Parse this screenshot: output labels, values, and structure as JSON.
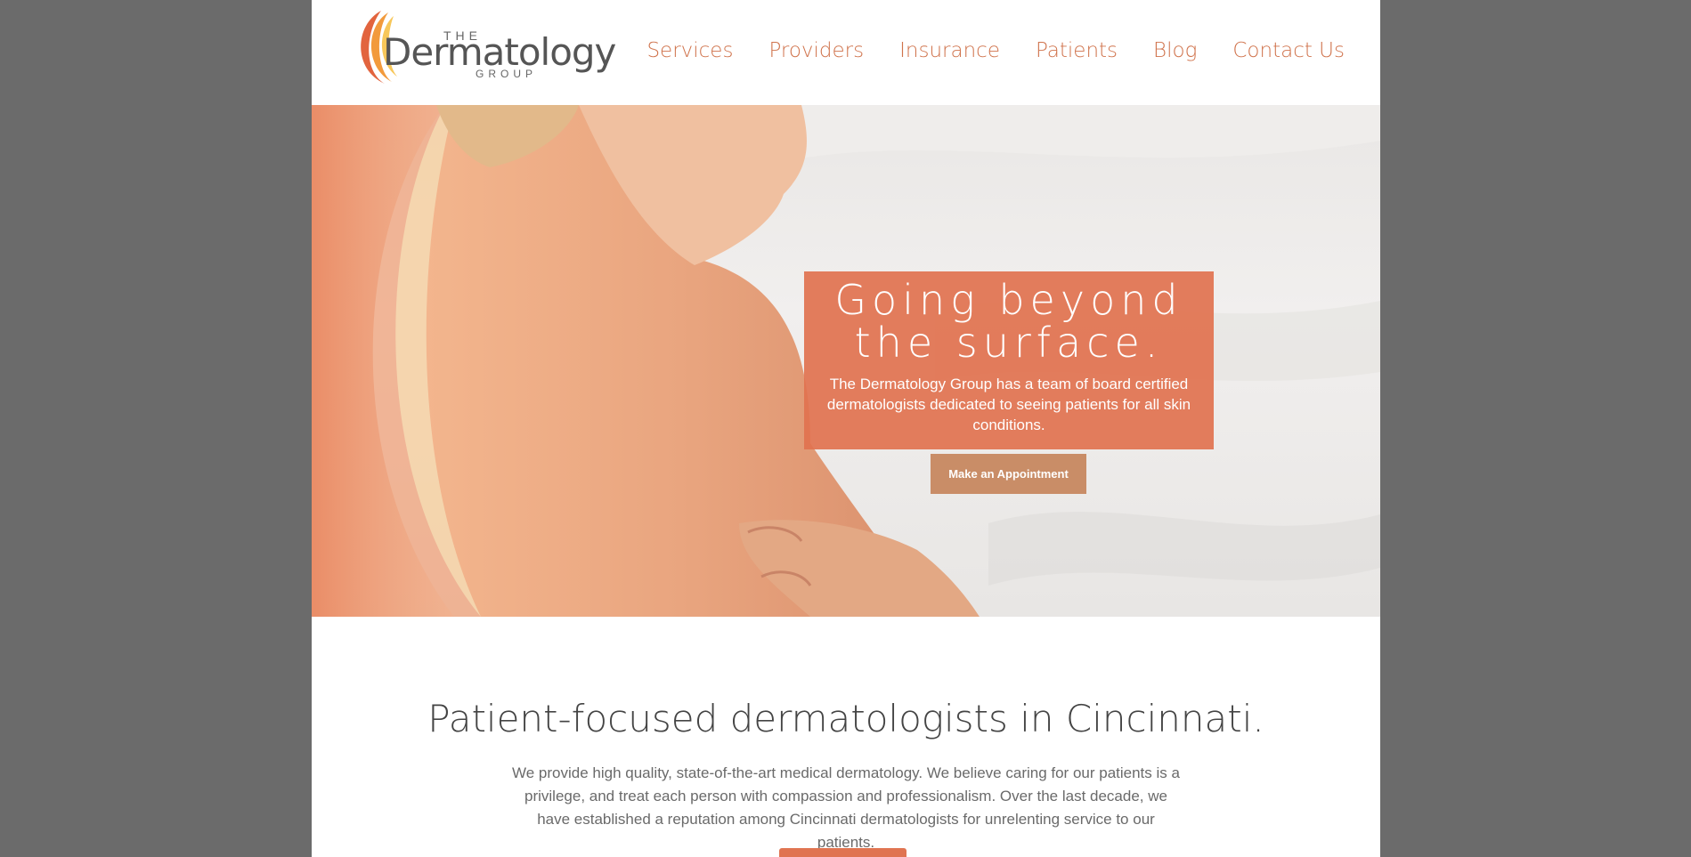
{
  "header": {
    "logo": {
      "the": "THE",
      "name": "Dermatology",
      "group": "GROUP"
    },
    "nav": [
      "Services",
      "Providers",
      "Insurance",
      "Patients",
      "Blog",
      "Contact Us"
    ]
  },
  "hero": {
    "title_line1": "Going beyond",
    "title_line2": "the surface.",
    "subtitle": "The Dermatology Group has a team of board certified dermatologists dedicated to seeing patients for all skin conditions.",
    "button": "Make an Appointment"
  },
  "intro": {
    "title": "Patient-focused dermatologists in Cincinnati.",
    "text": "We provide high quality, state-of-the-art medical dermatology. We believe caring for our patients is a privilege, and treat each person with compassion and professionalism. Over the last decade, we have established a reputation among Cincinnati dermatologists for unrelenting service to our patients."
  },
  "colors": {
    "accent": "#e07451",
    "nav_text": "#d0734c",
    "button": "#c98d67",
    "backdrop": "#6b6b6b"
  }
}
